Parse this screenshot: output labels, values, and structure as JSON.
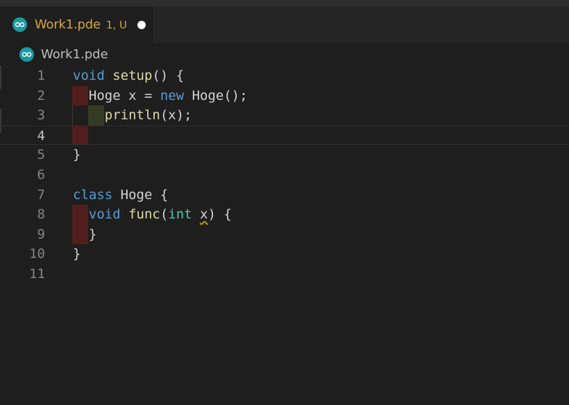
{
  "tab": {
    "icon": "arduino-icon",
    "title": "Work1.pde",
    "status": "1, U",
    "modified_indicator": "unsaved-dot"
  },
  "breadcrumb": {
    "icon": "arduino-icon",
    "label": "Work1.pde"
  },
  "colors": {
    "tab_title": "#d6a53a",
    "keyword": "#569cd6",
    "type": "#4ec9b0",
    "function": "#dcdcaa",
    "text": "#d4d4d4",
    "indent_error": "#5a1d1d",
    "indent_highlight": "#353b22",
    "warning_squiggle": "#cca700"
  },
  "editor": {
    "current_line": 4,
    "lines": [
      {
        "n": "1",
        "parts": [
          {
            "t": "void",
            "c": "kw"
          },
          {
            "t": " "
          },
          {
            "t": "setup",
            "c": "fn"
          },
          {
            "t": "() {"
          }
        ]
      },
      {
        "n": "2",
        "parts": [
          {
            "t": "  Hoge x = "
          },
          {
            "t": "new",
            "c": "kw"
          },
          {
            "t": " Hoge();"
          }
        ]
      },
      {
        "n": "3",
        "parts": [
          {
            "t": "    "
          },
          {
            "t": "println",
            "c": "fn"
          },
          {
            "t": "(x);"
          }
        ]
      },
      {
        "n": "4",
        "parts": []
      },
      {
        "n": "5",
        "parts": [
          {
            "t": "}"
          }
        ]
      },
      {
        "n": "6",
        "parts": []
      },
      {
        "n": "7",
        "parts": [
          {
            "t": "class",
            "c": "kw"
          },
          {
            "t": " Hoge {"
          }
        ]
      },
      {
        "n": "8",
        "parts": [
          {
            "t": "  "
          },
          {
            "t": "void",
            "c": "kw"
          },
          {
            "t": " "
          },
          {
            "t": "func",
            "c": "fn"
          },
          {
            "t": "("
          },
          {
            "t": "int",
            "c": "ty"
          },
          {
            "t": " "
          },
          {
            "t": "x",
            "c": "squiggle"
          },
          {
            "t": ") {"
          }
        ]
      },
      {
        "n": "9",
        "parts": [
          {
            "t": "  }"
          }
        ]
      },
      {
        "n": "10",
        "parts": [
          {
            "t": "}"
          }
        ]
      },
      {
        "n": "11",
        "parts": []
      }
    ]
  }
}
